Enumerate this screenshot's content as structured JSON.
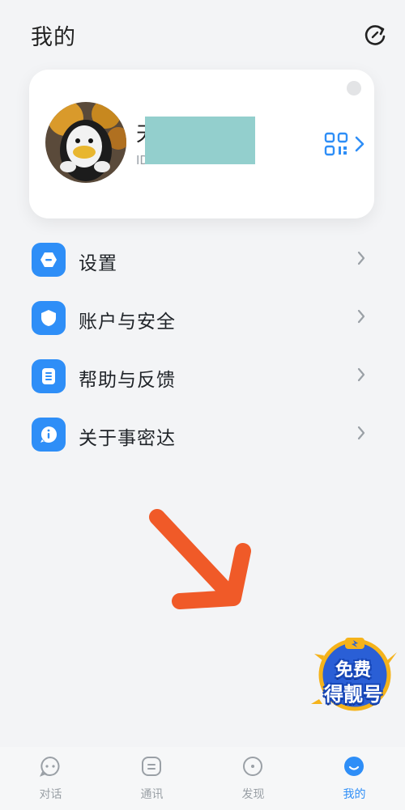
{
  "header": {
    "title": "我的"
  },
  "profile": {
    "name": "天",
    "id_label": "ID"
  },
  "menu": {
    "items": [
      {
        "label": "设置",
        "icon": "settings-icon"
      },
      {
        "label": "账户与安全",
        "icon": "shield-icon"
      },
      {
        "label": "帮助与反馈",
        "icon": "document-icon"
      },
      {
        "label": "关于事密达",
        "icon": "info-icon"
      }
    ]
  },
  "promo": {
    "line1": "免费",
    "line2": "得靓号"
  },
  "tabs": [
    {
      "label": "对话",
      "icon": "chat-icon"
    },
    {
      "label": "通讯",
      "icon": "contacts-icon"
    },
    {
      "label": "发现",
      "icon": "discover-icon"
    },
    {
      "label": "我的",
      "icon": "profile-icon"
    }
  ],
  "colors": {
    "accent": "#2e8ef7",
    "arrow": "#f05a28"
  }
}
